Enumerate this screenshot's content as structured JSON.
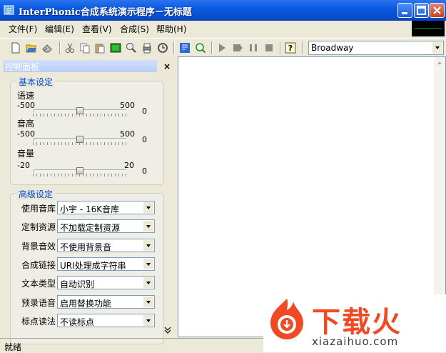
{
  "window": {
    "title": "InterPhonic合成系统演示程序－无标题",
    "buttons": [
      "minimize",
      "maximize",
      "close"
    ]
  },
  "menu": {
    "items": [
      "文件(F)",
      "编辑(E)",
      "查看(V)",
      "合成(S)",
      "帮助(H)"
    ]
  },
  "toolbar": {
    "icons": [
      "new-file-icon",
      "open-folder-icon",
      "eraser-icon",
      "cut-icon",
      "copy-icon",
      "paste-icon",
      "screen-icon",
      "find-icon",
      "print-icon",
      "replace-icon",
      "document-gear-icon",
      "find-magnifier-icon",
      "play-icon",
      "record-icon",
      "pause-icon",
      "stop-icon",
      "help-icon"
    ],
    "voice_select": "Broadway"
  },
  "panel": {
    "title": "控制面板",
    "close_glyph": "×"
  },
  "basic": {
    "title": "基本设定",
    "speed": {
      "label": "语速",
      "min": "-500",
      "max": "500",
      "value": "0",
      "level": 0.5
    },
    "pitch": {
      "label": "音高",
      "min": "-500",
      "max": "500",
      "value": "0",
      "level": 0.5
    },
    "volume": {
      "label": "音量",
      "min": "-20",
      "max": "20",
      "value": "0",
      "level": 0.5
    }
  },
  "advanced": {
    "title": "高级设定",
    "rows": [
      {
        "label": "使用音库",
        "value": "小宇 - 16K音库"
      },
      {
        "label": "定制资源",
        "value": "不加载定制资源"
      },
      {
        "label": "背景音效",
        "value": "不使用背景音"
      },
      {
        "label": "合成链接",
        "value": "URI处理成字符串"
      },
      {
        "label": "文本类型",
        "value": "自动识别"
      },
      {
        "label": "预录语音",
        "value": "启用替换功能"
      },
      {
        "label": "标点读法",
        "value": "不读标点"
      }
    ]
  },
  "status": {
    "text": "就绪"
  },
  "watermark": {
    "big": "下载火",
    "small": "xiazaihuo.com"
  },
  "colors": {
    "accent": "#0046d5",
    "brand": "#ef4a23",
    "titlebar": "#0a5ae0"
  }
}
